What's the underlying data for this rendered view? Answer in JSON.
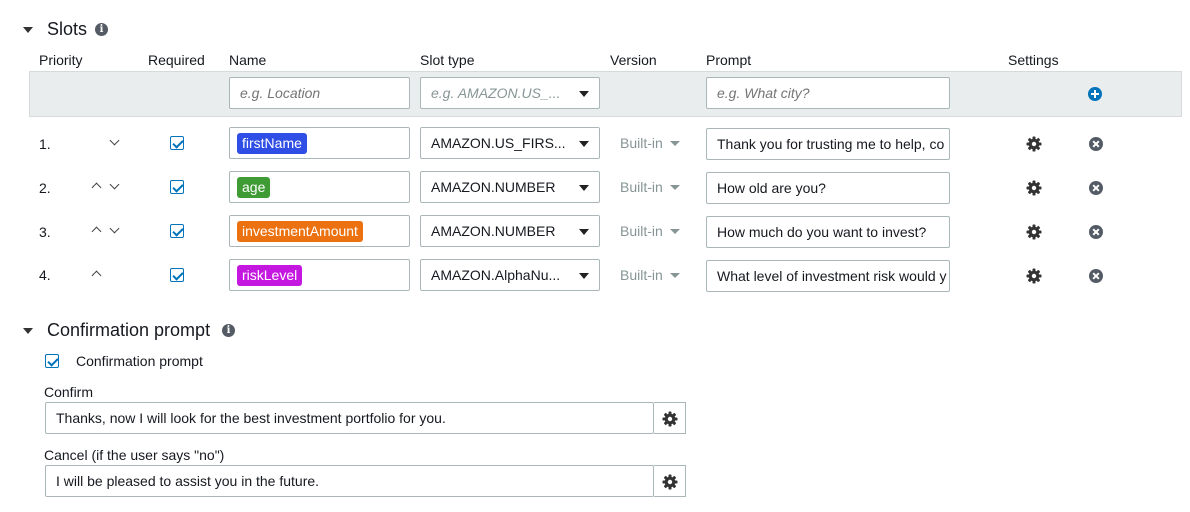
{
  "slots_section": {
    "title": "Slots",
    "info_icon": "info-icon"
  },
  "columns": {
    "priority": "Priority",
    "required": "Required",
    "name": "Name",
    "slot_type": "Slot type",
    "version": "Version",
    "prompt": "Prompt",
    "settings": "Settings"
  },
  "new_slot": {
    "name_placeholder": "e.g. Location",
    "slot_type_placeholder": "e.g. AMAZON.US_...",
    "prompt_placeholder": "e.g. What city?",
    "add_icon": "plus-circle-icon"
  },
  "slots": [
    {
      "number": "1.",
      "required": true,
      "name": "firstName",
      "tag_color": "#2f4ee5",
      "slot_type": "AMAZON.US_FIRS...",
      "version": "Built-in",
      "prompt": "Thank you for trusting me to help, co"
    },
    {
      "number": "2.",
      "required": true,
      "name": "age",
      "tag_color": "#3f9c35",
      "slot_type": "AMAZON.NUMBER",
      "version": "Built-in",
      "prompt": "How old are you?"
    },
    {
      "number": "3.",
      "required": true,
      "name": "investmentAmount",
      "tag_color": "#ec7211",
      "slot_type": "AMAZON.NUMBER",
      "version": "Built-in",
      "prompt": "How much do you want to invest?"
    },
    {
      "number": "4.",
      "required": true,
      "name": "riskLevel",
      "tag_color": "#c418e0",
      "slot_type": "AMAZON.AlphaNu...",
      "version": "Built-in",
      "prompt": "What level of investment risk would y"
    }
  ],
  "confirmation_section": {
    "title": "Confirmation prompt",
    "checkbox_label": "Confirmation prompt",
    "checked": true,
    "confirm_label": "Confirm",
    "confirm_value": "Thanks, now I will look for the best investment portfolio for you.",
    "cancel_label": "Cancel (if the user says \"no\")",
    "cancel_value": "I will be pleased to assist you in the future."
  }
}
